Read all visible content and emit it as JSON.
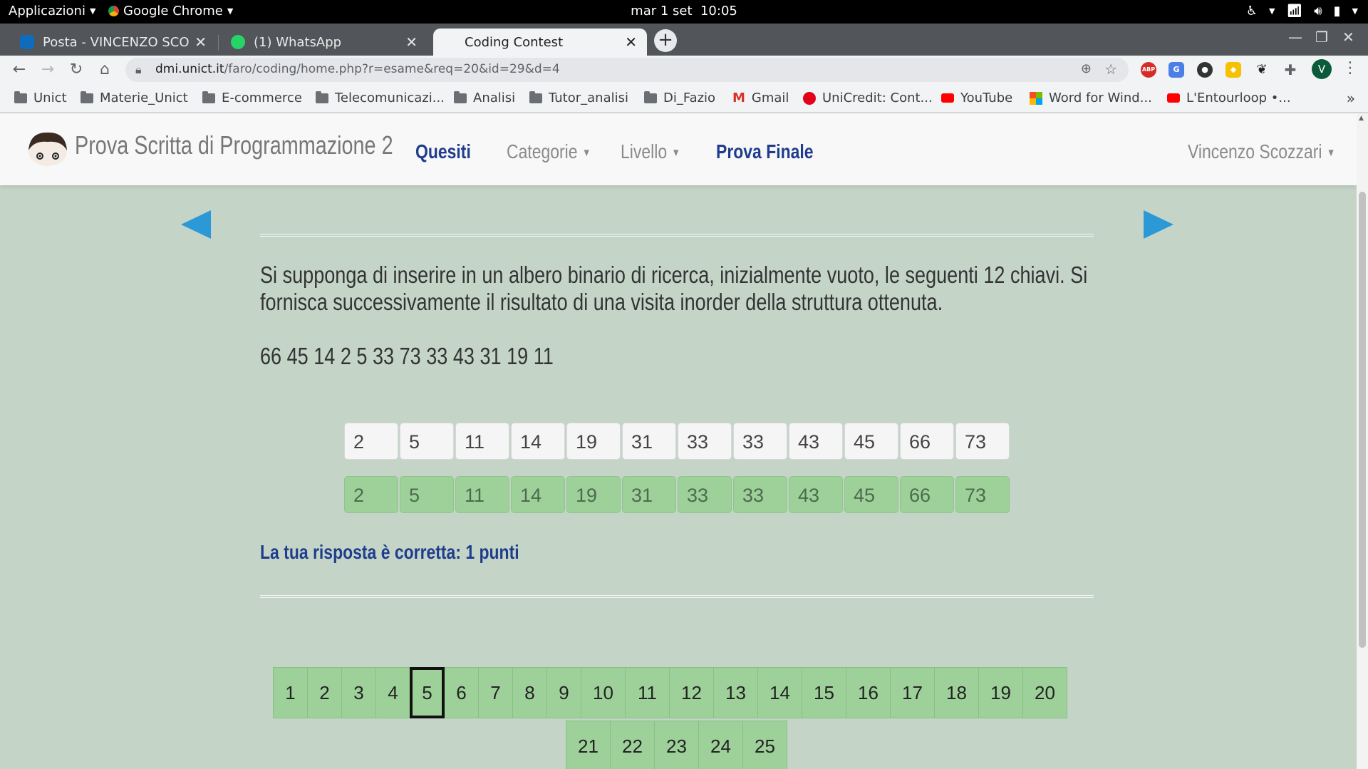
{
  "os": {
    "apps_menu": "Applicazioni",
    "app_name": "Google Chrome",
    "clock": "mar 1 set  10:05"
  },
  "tabs": [
    {
      "title": "Posta - VINCENZO SCOZZARI",
      "active": false,
      "favicon_color": "#0f6cbd"
    },
    {
      "title": "(1) WhatsApp",
      "active": false,
      "favicon_color": "#25d366"
    },
    {
      "title": "Coding Contest",
      "active": true
    }
  ],
  "address_bar": {
    "host": "dmi.unict.it",
    "path": "/faro/coding/home.php?r=esame&req=20&id=29&d=4"
  },
  "profile_initial": "V",
  "bookmarks": [
    {
      "label": "Unict",
      "icon": "folder-icon"
    },
    {
      "label": "Materie_Unict",
      "icon": "folder-icon"
    },
    {
      "label": "E-commerce",
      "icon": "folder-icon"
    },
    {
      "label": "Telecomunicazi...",
      "icon": "folder-icon"
    },
    {
      "label": "Analisi",
      "icon": "folder-icon"
    },
    {
      "label": "Tutor_analisi",
      "icon": "folder-icon"
    },
    {
      "label": "Di_Fazio",
      "icon": "folder-icon"
    },
    {
      "label": "Gmail",
      "icon": "gmail-icon"
    },
    {
      "label": "UniCredit: Cont...",
      "icon": "unicredit-icon"
    },
    {
      "label": "YouTube",
      "icon": "youtube-icon"
    },
    {
      "label": "Word for Wind...",
      "icon": "microsoft-icon"
    },
    {
      "label": "L'Entourloop •...",
      "icon": "youtube-icon"
    }
  ],
  "site": {
    "brand": "Prova Scritta di Programmazione 2",
    "nav": {
      "quesiti": "Quesiti",
      "categorie": "Categorie",
      "livello": "Livello",
      "prova_finale": "Prova Finale",
      "user": "Vincenzo Scozzari"
    }
  },
  "question": {
    "text": "Si supponga di inserire in un albero binario di ricerca, inizialmente vuoto, le seguenti 12 chiavi. Si fornisca successivamente il risultato di una visita inorder della struttura ottenuta.",
    "keys": "66 45 14 2 5 33 73 33 43 31 19 11",
    "answer": [
      "2",
      "5",
      "11",
      "14",
      "19",
      "31",
      "33",
      "33",
      "43",
      "45",
      "66",
      "73"
    ],
    "solution": [
      "2",
      "5",
      "11",
      "14",
      "19",
      "31",
      "33",
      "33",
      "43",
      "45",
      "66",
      "73"
    ],
    "result": "La tua risposta è corretta: 1 punti"
  },
  "pagination": {
    "current": "5",
    "row1": [
      "1",
      "2",
      "3",
      "4",
      "5",
      "6",
      "7",
      "8",
      "9",
      "10",
      "11",
      "12",
      "13",
      "14",
      "15",
      "16",
      "17",
      "18",
      "19",
      "20"
    ],
    "row2": [
      "21",
      "22",
      "23",
      "24",
      "25"
    ]
  },
  "colors": {
    "accent_blue": "#1f3d8c",
    "arrow_blue": "#2b99d6",
    "correct_green": "#9ed19a",
    "page_bg": "#c4d5c8"
  }
}
